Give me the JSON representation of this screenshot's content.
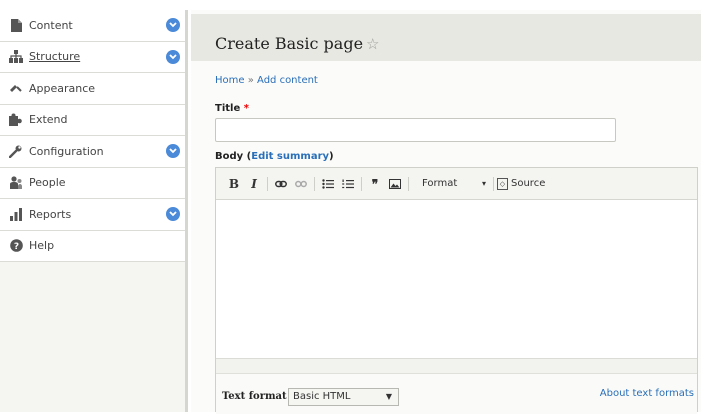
{
  "sidebar": {
    "items": [
      {
        "label": "Content",
        "icon": "page-icon",
        "has_toggle": true
      },
      {
        "label": "Structure",
        "icon": "sitemap-icon",
        "has_toggle": true
      },
      {
        "label": "Appearance",
        "icon": "paintbrush-icon",
        "has_toggle": false
      },
      {
        "label": "Extend",
        "icon": "puzzle-icon",
        "has_toggle": false
      },
      {
        "label": "Configuration",
        "icon": "wrench-icon",
        "has_toggle": true
      },
      {
        "label": "People",
        "icon": "people-icon",
        "has_toggle": false
      },
      {
        "label": "Reports",
        "icon": "bar-chart-icon",
        "has_toggle": true
      },
      {
        "label": "Help",
        "icon": "help-icon",
        "has_toggle": false
      }
    ]
  },
  "page": {
    "title": "Create Basic page",
    "breadcrumb": {
      "home": "Home",
      "separator": "»",
      "current": "Add content"
    }
  },
  "form": {
    "title_label": "Title",
    "required_mark": "*",
    "title_value": "",
    "body_label": "Body",
    "edit_summary_open": "(",
    "edit_summary": "Edit summary",
    "edit_summary_close": ")"
  },
  "toolbar": {
    "bold": "B",
    "italic": "I",
    "blockquote": "❞",
    "format_label": "Format",
    "source_label": "Source"
  },
  "text_format": {
    "label": "Text format",
    "selected": "Basic HTML",
    "about_link": "About text formats"
  },
  "colors": {
    "accent": "#4a8ad8",
    "link": "#2a6fb8",
    "required": "#e00000"
  }
}
